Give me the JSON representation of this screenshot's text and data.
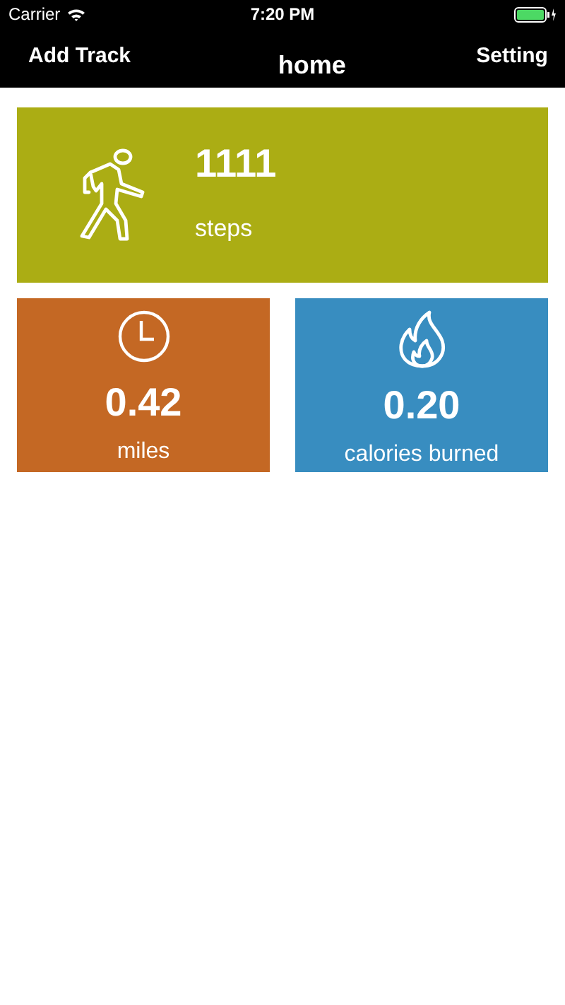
{
  "status_bar": {
    "carrier": "Carrier",
    "time": "7:20 PM"
  },
  "nav_bar": {
    "left_button": "Add Track",
    "title": "home",
    "right_button": "Setting"
  },
  "main_card": {
    "value": "1111",
    "label": "steps",
    "color": "#abad14"
  },
  "cards": [
    {
      "kind": "clock",
      "value": "0.42",
      "label": "miles",
      "color": "#c46824"
    },
    {
      "kind": "flame",
      "value": "0.20",
      "label": "calories burned",
      "color": "#388dc0"
    }
  ]
}
